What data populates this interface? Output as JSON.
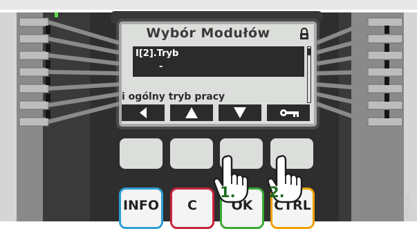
{
  "lcd": {
    "title": "Wybór Modułów",
    "lock_icon": "lock-icon",
    "selected_item": {
      "label": "I[2].Tryb",
      "value": "-"
    },
    "help_text": "i ogólny tryb pracy",
    "softkeys": [
      {
        "icon": "arrow-left-icon"
      },
      {
        "icon": "arrow-up-icon"
      },
      {
        "icon": "arrow-down-icon"
      },
      {
        "icon": "key-icon"
      }
    ]
  },
  "keys": {
    "info": "INFO",
    "c": "C",
    "ok": "OK",
    "ctrl": "CTRL"
  },
  "steps": {
    "first": "1.",
    "second": "2."
  },
  "watermark": "HPT_ZAE",
  "colors": {
    "device_body": "#2e2e2e",
    "lcd_background": "#dcdedb",
    "lcd_foreground": "#2b2b2b",
    "info_ring": "#2f9fd6",
    "c_ring": "#c8233c",
    "ok_ring": "#3aaa35",
    "ctrl_ring": "#f0a100",
    "step_label": "#1f6b1f"
  }
}
